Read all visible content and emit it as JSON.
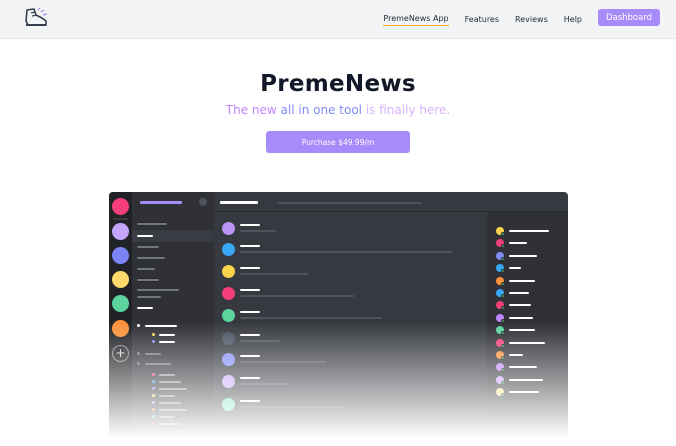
{
  "nav": {
    "links": [
      "PremeNews App",
      "Features",
      "Reviews",
      "Help"
    ],
    "dashboard_label": "Dashboard",
    "logo_icon": "sneaker-icon"
  },
  "hero": {
    "title": "PremeNews",
    "subtitle_part1": "The new ",
    "subtitle_part2": "all in one tool",
    "subtitle_part3": " is finally ",
    "subtitle_part4": "here.",
    "cta_label": "Purchase $49.99/m"
  },
  "colors": {
    "accent": "#a78bfa",
    "nav_underline": "#f5a623",
    "guilds": [
      "#f43f7a",
      "#c4a6f9",
      "#7c83f5",
      "#fdd96b",
      "#5dd39e",
      "#fb923c"
    ],
    "message_avatars": [
      "#b794f6",
      "#38a8f5",
      "#fcd34d",
      "#f43f7a",
      "#5dd39e",
      "#4b5563",
      "#818cf8",
      "#c4a6f9",
      "#6ee7b7"
    ],
    "member_avatars": [
      "#fcd34d",
      "#f43f7a",
      "#818cf8",
      "#38a8f5",
      "#fb923c",
      "#38a8f5",
      "#f43f7a",
      "#c084fc",
      "#5dd39e",
      "#f43f7a",
      "#fb923c",
      "#c084fc",
      "#c4a6f9",
      "#fde68a"
    ]
  }
}
